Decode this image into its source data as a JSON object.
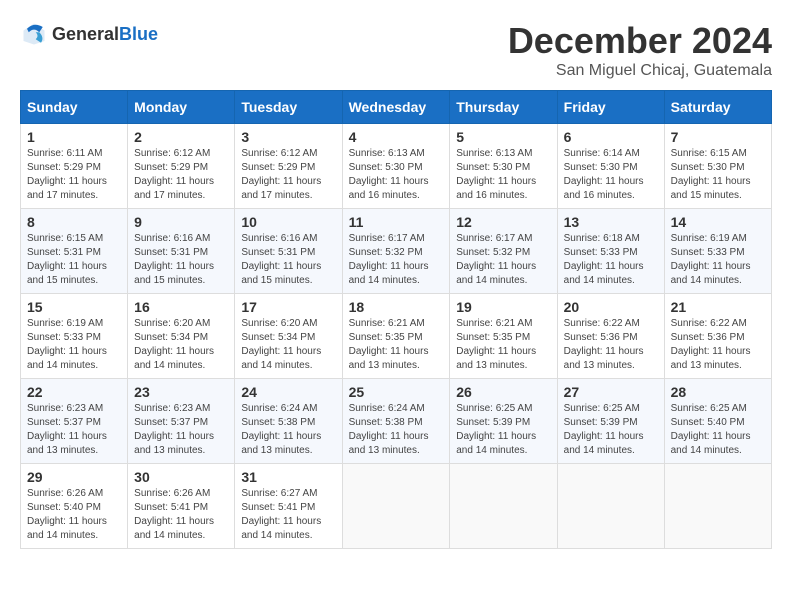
{
  "header": {
    "logo_general": "General",
    "logo_blue": "Blue",
    "month": "December 2024",
    "location": "San Miguel Chicaj, Guatemala"
  },
  "days_of_week": [
    "Sunday",
    "Monday",
    "Tuesday",
    "Wednesday",
    "Thursday",
    "Friday",
    "Saturday"
  ],
  "weeks": [
    [
      {
        "day": "1",
        "sunrise": "6:11 AM",
        "sunset": "5:29 PM",
        "daylight": "11 hours and 17 minutes."
      },
      {
        "day": "2",
        "sunrise": "6:12 AM",
        "sunset": "5:29 PM",
        "daylight": "11 hours and 17 minutes."
      },
      {
        "day": "3",
        "sunrise": "6:12 AM",
        "sunset": "5:29 PM",
        "daylight": "11 hours and 17 minutes."
      },
      {
        "day": "4",
        "sunrise": "6:13 AM",
        "sunset": "5:30 PM",
        "daylight": "11 hours and 16 minutes."
      },
      {
        "day": "5",
        "sunrise": "6:13 AM",
        "sunset": "5:30 PM",
        "daylight": "11 hours and 16 minutes."
      },
      {
        "day": "6",
        "sunrise": "6:14 AM",
        "sunset": "5:30 PM",
        "daylight": "11 hours and 16 minutes."
      },
      {
        "day": "7",
        "sunrise": "6:15 AM",
        "sunset": "5:30 PM",
        "daylight": "11 hours and 15 minutes."
      }
    ],
    [
      {
        "day": "8",
        "sunrise": "6:15 AM",
        "sunset": "5:31 PM",
        "daylight": "11 hours and 15 minutes."
      },
      {
        "day": "9",
        "sunrise": "6:16 AM",
        "sunset": "5:31 PM",
        "daylight": "11 hours and 15 minutes."
      },
      {
        "day": "10",
        "sunrise": "6:16 AM",
        "sunset": "5:31 PM",
        "daylight": "11 hours and 15 minutes."
      },
      {
        "day": "11",
        "sunrise": "6:17 AM",
        "sunset": "5:32 PM",
        "daylight": "11 hours and 14 minutes."
      },
      {
        "day": "12",
        "sunrise": "6:17 AM",
        "sunset": "5:32 PM",
        "daylight": "11 hours and 14 minutes."
      },
      {
        "day": "13",
        "sunrise": "6:18 AM",
        "sunset": "5:33 PM",
        "daylight": "11 hours and 14 minutes."
      },
      {
        "day": "14",
        "sunrise": "6:19 AM",
        "sunset": "5:33 PM",
        "daylight": "11 hours and 14 minutes."
      }
    ],
    [
      {
        "day": "15",
        "sunrise": "6:19 AM",
        "sunset": "5:33 PM",
        "daylight": "11 hours and 14 minutes."
      },
      {
        "day": "16",
        "sunrise": "6:20 AM",
        "sunset": "5:34 PM",
        "daylight": "11 hours and 14 minutes."
      },
      {
        "day": "17",
        "sunrise": "6:20 AM",
        "sunset": "5:34 PM",
        "daylight": "11 hours and 14 minutes."
      },
      {
        "day": "18",
        "sunrise": "6:21 AM",
        "sunset": "5:35 PM",
        "daylight": "11 hours and 13 minutes."
      },
      {
        "day": "19",
        "sunrise": "6:21 AM",
        "sunset": "5:35 PM",
        "daylight": "11 hours and 13 minutes."
      },
      {
        "day": "20",
        "sunrise": "6:22 AM",
        "sunset": "5:36 PM",
        "daylight": "11 hours and 13 minutes."
      },
      {
        "day": "21",
        "sunrise": "6:22 AM",
        "sunset": "5:36 PM",
        "daylight": "11 hours and 13 minutes."
      }
    ],
    [
      {
        "day": "22",
        "sunrise": "6:23 AM",
        "sunset": "5:37 PM",
        "daylight": "11 hours and 13 minutes."
      },
      {
        "day": "23",
        "sunrise": "6:23 AM",
        "sunset": "5:37 PM",
        "daylight": "11 hours and 13 minutes."
      },
      {
        "day": "24",
        "sunrise": "6:24 AM",
        "sunset": "5:38 PM",
        "daylight": "11 hours and 13 minutes."
      },
      {
        "day": "25",
        "sunrise": "6:24 AM",
        "sunset": "5:38 PM",
        "daylight": "11 hours and 13 minutes."
      },
      {
        "day": "26",
        "sunrise": "6:25 AM",
        "sunset": "5:39 PM",
        "daylight": "11 hours and 14 minutes."
      },
      {
        "day": "27",
        "sunrise": "6:25 AM",
        "sunset": "5:39 PM",
        "daylight": "11 hours and 14 minutes."
      },
      {
        "day": "28",
        "sunrise": "6:25 AM",
        "sunset": "5:40 PM",
        "daylight": "11 hours and 14 minutes."
      }
    ],
    [
      {
        "day": "29",
        "sunrise": "6:26 AM",
        "sunset": "5:40 PM",
        "daylight": "11 hours and 14 minutes."
      },
      {
        "day": "30",
        "sunrise": "6:26 AM",
        "sunset": "5:41 PM",
        "daylight": "11 hours and 14 minutes."
      },
      {
        "day": "31",
        "sunrise": "6:27 AM",
        "sunset": "5:41 PM",
        "daylight": "11 hours and 14 minutes."
      },
      null,
      null,
      null,
      null
    ]
  ],
  "labels": {
    "sunrise_prefix": "Sunrise: ",
    "sunset_prefix": "Sunset: ",
    "daylight_prefix": "Daylight: "
  }
}
